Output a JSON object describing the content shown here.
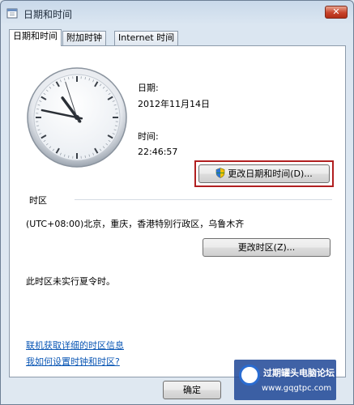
{
  "window": {
    "title": "日期和时间",
    "close_label": "✕"
  },
  "tabs": [
    {
      "label": "日期和时间",
      "active": true
    },
    {
      "label": "附加时钟",
      "active": false
    },
    {
      "label": "Internet 时间",
      "active": false
    }
  ],
  "clock": {
    "hour": 22,
    "minute": 46,
    "second": 57
  },
  "date": {
    "label": "日期:",
    "value": "2012年11月14日"
  },
  "time": {
    "label": "时间:",
    "value": "22:46:57"
  },
  "change_datetime_button": "更改日期和时间(D)...",
  "timezone": {
    "heading": "时区",
    "value": "(UTC+08:00)北京，重庆，香港特别行政区，乌鲁木齐",
    "change_button": "更改时区(Z)...",
    "dst_note": "此时区未实行夏令时。"
  },
  "links": {
    "online_info": "联机获取详细的时区信息",
    "how_to": "我如何设置时钟和时区?"
  },
  "footer": {
    "ok_label": "确定"
  },
  "watermark": {
    "line1": "过期罐头电脑论坛",
    "line2": "www.gqgtpc.com"
  },
  "colors": {
    "highlight": "#b11f20",
    "link": "#0b57b5",
    "close": "#c8432b"
  }
}
